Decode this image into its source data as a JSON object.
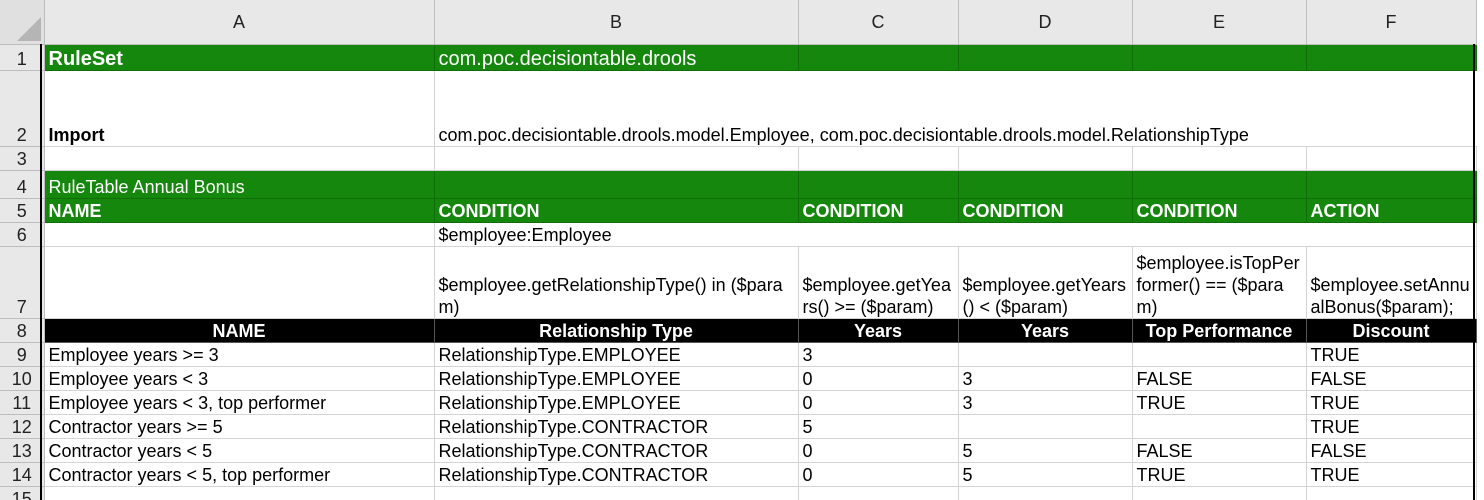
{
  "columns": [
    "A",
    "B",
    "C",
    "D",
    "E",
    "F"
  ],
  "rows": [
    {
      "n": "1",
      "cells": [
        "RuleSet",
        "com.poc.decisiontable.drools",
        "",
        "",
        "",
        ""
      ]
    },
    {
      "n": "2",
      "cells": [
        "Import",
        "com.poc.decisiontable.drools.model.Employee, com.poc.decisiontable.drools.model.RelationshipType",
        "",
        "",
        "",
        ""
      ]
    },
    {
      "n": "3",
      "cells": [
        "",
        "",
        "",
        "",
        "",
        ""
      ]
    },
    {
      "n": "4",
      "cells": [
        "RuleTable Annual Bonus",
        "",
        "",
        "",
        "",
        ""
      ]
    },
    {
      "n": "5",
      "cells": [
        "NAME",
        "CONDITION",
        "CONDITION",
        "CONDITION",
        "CONDITION",
        "ACTION"
      ]
    },
    {
      "n": "6",
      "cells": [
        "",
        "$employee:Employee",
        "",
        "",
        "",
        ""
      ]
    },
    {
      "n": "7",
      "cells": [
        "",
        "$employee.getRelationshipType() in ($param)",
        "$employee.getYears() >= ($param)",
        "$employee.getYears() < ($param)",
        "$employee.isTopPerformer() == ($param)",
        "$employee.setAnnualBonus($param);"
      ]
    },
    {
      "n": "8",
      "cells": [
        "NAME",
        "Relationship Type",
        "Years",
        "Years",
        "Top Performance",
        "Discount"
      ]
    },
    {
      "n": "9",
      "cells": [
        "Employee years >= 3",
        "RelationshipType.EMPLOYEE",
        "3",
        "",
        "",
        "TRUE"
      ]
    },
    {
      "n": "10",
      "cells": [
        "Employee years < 3",
        "RelationshipType.EMPLOYEE",
        "0",
        "3",
        "FALSE",
        "FALSE"
      ]
    },
    {
      "n": "11",
      "cells": [
        "Employee years < 3, top performer",
        "RelationshipType.EMPLOYEE",
        "0",
        "3",
        "TRUE",
        "TRUE"
      ]
    },
    {
      "n": "12",
      "cells": [
        "Contractor years >= 5",
        "RelationshipType.CONTRACTOR",
        "5",
        "",
        "",
        "TRUE"
      ]
    },
    {
      "n": "13",
      "cells": [
        "Contractor years < 5",
        "RelationshipType.CONTRACTOR",
        "0",
        "5",
        "FALSE",
        "FALSE"
      ]
    },
    {
      "n": "14",
      "cells": [
        "Contractor years < 5, top performer",
        "RelationshipType.CONTRACTOR",
        "0",
        "5",
        "TRUE",
        "TRUE"
      ]
    },
    {
      "n": "15",
      "cells": [
        "",
        "",
        "",
        "",
        "",
        ""
      ]
    }
  ],
  "colors": {
    "header_green": "#14870c",
    "column_header_black": "#000000",
    "gridline": "#d4d4d4",
    "row_header_bg": "#e8e8e8"
  }
}
